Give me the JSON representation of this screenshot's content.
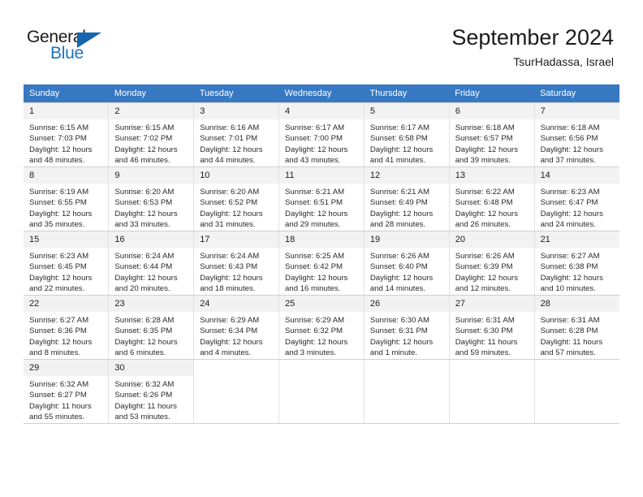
{
  "brand": {
    "name_top": "General",
    "name_bottom": "Blue",
    "accent_color": "#1565b0"
  },
  "header": {
    "title": "September 2024",
    "subtitle": "TsurHadassa, Israel"
  },
  "calendar": {
    "header_bg": "#3778c2",
    "daynum_bg": "#f2f2f2",
    "weekdays": [
      "Sunday",
      "Monday",
      "Tuesday",
      "Wednesday",
      "Thursday",
      "Friday",
      "Saturday"
    ],
    "weeks": [
      [
        {
          "day": "1",
          "sunrise": "Sunrise: 6:15 AM",
          "sunset": "Sunset: 7:03 PM",
          "daylight1": "Daylight: 12 hours",
          "daylight2": "and 48 minutes."
        },
        {
          "day": "2",
          "sunrise": "Sunrise: 6:15 AM",
          "sunset": "Sunset: 7:02 PM",
          "daylight1": "Daylight: 12 hours",
          "daylight2": "and 46 minutes."
        },
        {
          "day": "3",
          "sunrise": "Sunrise: 6:16 AM",
          "sunset": "Sunset: 7:01 PM",
          "daylight1": "Daylight: 12 hours",
          "daylight2": "and 44 minutes."
        },
        {
          "day": "4",
          "sunrise": "Sunrise: 6:17 AM",
          "sunset": "Sunset: 7:00 PM",
          "daylight1": "Daylight: 12 hours",
          "daylight2": "and 43 minutes."
        },
        {
          "day": "5",
          "sunrise": "Sunrise: 6:17 AM",
          "sunset": "Sunset: 6:58 PM",
          "daylight1": "Daylight: 12 hours",
          "daylight2": "and 41 minutes."
        },
        {
          "day": "6",
          "sunrise": "Sunrise: 6:18 AM",
          "sunset": "Sunset: 6:57 PM",
          "daylight1": "Daylight: 12 hours",
          "daylight2": "and 39 minutes."
        },
        {
          "day": "7",
          "sunrise": "Sunrise: 6:18 AM",
          "sunset": "Sunset: 6:56 PM",
          "daylight1": "Daylight: 12 hours",
          "daylight2": "and 37 minutes."
        }
      ],
      [
        {
          "day": "8",
          "sunrise": "Sunrise: 6:19 AM",
          "sunset": "Sunset: 6:55 PM",
          "daylight1": "Daylight: 12 hours",
          "daylight2": "and 35 minutes."
        },
        {
          "day": "9",
          "sunrise": "Sunrise: 6:20 AM",
          "sunset": "Sunset: 6:53 PM",
          "daylight1": "Daylight: 12 hours",
          "daylight2": "and 33 minutes."
        },
        {
          "day": "10",
          "sunrise": "Sunrise: 6:20 AM",
          "sunset": "Sunset: 6:52 PM",
          "daylight1": "Daylight: 12 hours",
          "daylight2": "and 31 minutes."
        },
        {
          "day": "11",
          "sunrise": "Sunrise: 6:21 AM",
          "sunset": "Sunset: 6:51 PM",
          "daylight1": "Daylight: 12 hours",
          "daylight2": "and 29 minutes."
        },
        {
          "day": "12",
          "sunrise": "Sunrise: 6:21 AM",
          "sunset": "Sunset: 6:49 PM",
          "daylight1": "Daylight: 12 hours",
          "daylight2": "and 28 minutes."
        },
        {
          "day": "13",
          "sunrise": "Sunrise: 6:22 AM",
          "sunset": "Sunset: 6:48 PM",
          "daylight1": "Daylight: 12 hours",
          "daylight2": "and 26 minutes."
        },
        {
          "day": "14",
          "sunrise": "Sunrise: 6:23 AM",
          "sunset": "Sunset: 6:47 PM",
          "daylight1": "Daylight: 12 hours",
          "daylight2": "and 24 minutes."
        }
      ],
      [
        {
          "day": "15",
          "sunrise": "Sunrise: 6:23 AM",
          "sunset": "Sunset: 6:45 PM",
          "daylight1": "Daylight: 12 hours",
          "daylight2": "and 22 minutes."
        },
        {
          "day": "16",
          "sunrise": "Sunrise: 6:24 AM",
          "sunset": "Sunset: 6:44 PM",
          "daylight1": "Daylight: 12 hours",
          "daylight2": "and 20 minutes."
        },
        {
          "day": "17",
          "sunrise": "Sunrise: 6:24 AM",
          "sunset": "Sunset: 6:43 PM",
          "daylight1": "Daylight: 12 hours",
          "daylight2": "and 18 minutes."
        },
        {
          "day": "18",
          "sunrise": "Sunrise: 6:25 AM",
          "sunset": "Sunset: 6:42 PM",
          "daylight1": "Daylight: 12 hours",
          "daylight2": "and 16 minutes."
        },
        {
          "day": "19",
          "sunrise": "Sunrise: 6:26 AM",
          "sunset": "Sunset: 6:40 PM",
          "daylight1": "Daylight: 12 hours",
          "daylight2": "and 14 minutes."
        },
        {
          "day": "20",
          "sunrise": "Sunrise: 6:26 AM",
          "sunset": "Sunset: 6:39 PM",
          "daylight1": "Daylight: 12 hours",
          "daylight2": "and 12 minutes."
        },
        {
          "day": "21",
          "sunrise": "Sunrise: 6:27 AM",
          "sunset": "Sunset: 6:38 PM",
          "daylight1": "Daylight: 12 hours",
          "daylight2": "and 10 minutes."
        }
      ],
      [
        {
          "day": "22",
          "sunrise": "Sunrise: 6:27 AM",
          "sunset": "Sunset: 6:36 PM",
          "daylight1": "Daylight: 12 hours",
          "daylight2": "and 8 minutes."
        },
        {
          "day": "23",
          "sunrise": "Sunrise: 6:28 AM",
          "sunset": "Sunset: 6:35 PM",
          "daylight1": "Daylight: 12 hours",
          "daylight2": "and 6 minutes."
        },
        {
          "day": "24",
          "sunrise": "Sunrise: 6:29 AM",
          "sunset": "Sunset: 6:34 PM",
          "daylight1": "Daylight: 12 hours",
          "daylight2": "and 4 minutes."
        },
        {
          "day": "25",
          "sunrise": "Sunrise: 6:29 AM",
          "sunset": "Sunset: 6:32 PM",
          "daylight1": "Daylight: 12 hours",
          "daylight2": "and 3 minutes."
        },
        {
          "day": "26",
          "sunrise": "Sunrise: 6:30 AM",
          "sunset": "Sunset: 6:31 PM",
          "daylight1": "Daylight: 12 hours",
          "daylight2": "and 1 minute."
        },
        {
          "day": "27",
          "sunrise": "Sunrise: 6:31 AM",
          "sunset": "Sunset: 6:30 PM",
          "daylight1": "Daylight: 11 hours",
          "daylight2": "and 59 minutes."
        },
        {
          "day": "28",
          "sunrise": "Sunrise: 6:31 AM",
          "sunset": "Sunset: 6:28 PM",
          "daylight1": "Daylight: 11 hours",
          "daylight2": "and 57 minutes."
        }
      ],
      [
        {
          "day": "29",
          "sunrise": "Sunrise: 6:32 AM",
          "sunset": "Sunset: 6:27 PM",
          "daylight1": "Daylight: 11 hours",
          "daylight2": "and 55 minutes."
        },
        {
          "day": "30",
          "sunrise": "Sunrise: 6:32 AM",
          "sunset": "Sunset: 6:26 PM",
          "daylight1": "Daylight: 11 hours",
          "daylight2": "and 53 minutes."
        },
        {
          "day": "",
          "sunrise": "",
          "sunset": "",
          "daylight1": "",
          "daylight2": ""
        },
        {
          "day": "",
          "sunrise": "",
          "sunset": "",
          "daylight1": "",
          "daylight2": ""
        },
        {
          "day": "",
          "sunrise": "",
          "sunset": "",
          "daylight1": "",
          "daylight2": ""
        },
        {
          "day": "",
          "sunrise": "",
          "sunset": "",
          "daylight1": "",
          "daylight2": ""
        },
        {
          "day": "",
          "sunrise": "",
          "sunset": "",
          "daylight1": "",
          "daylight2": ""
        }
      ]
    ]
  }
}
